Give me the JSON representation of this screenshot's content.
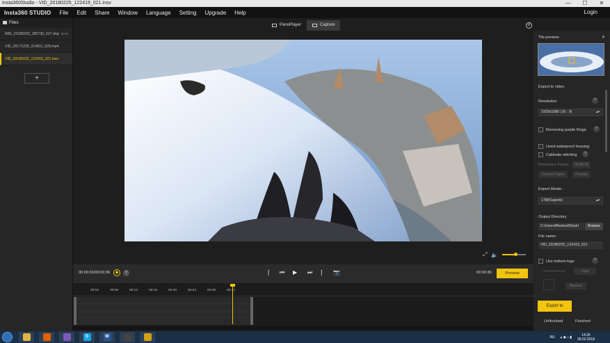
{
  "window": {
    "title": "Insta360Studio - VID_20180225_122419_021.insv",
    "min": "—",
    "max": "☐",
    "close": "✕"
  },
  "menubar": {
    "logo": "Insta360 STUDIO",
    "items": [
      "File",
      "Edit",
      "Share",
      "Window",
      "Language",
      "Setting",
      "Upgrade",
      "Help"
    ],
    "login": "Login"
  },
  "sidebar": {
    "header": "Files",
    "files": [
      {
        "name": "IMG_20180203_180730_017.dng",
        "badge": "RAW"
      },
      {
        "name": "VID_20171228_214811_029.mp4",
        "badge": ""
      },
      {
        "name": "VID_20180225_122419_021.insv",
        "badge": ""
      }
    ],
    "add_label": "+"
  },
  "view_tabs": [
    {
      "label": "PanoPlayer"
    },
    {
      "label": "Capture"
    }
  ],
  "player": {
    "current_time": "00:00:32/00:00:36",
    "end_time": "00:00:36",
    "preview_label": "Preview",
    "volume_fraction": 0.55
  },
  "timeline": {
    "ticks": [
      "00:04",
      "00:08",
      "00:12",
      "00:16",
      "00:20",
      "00:24",
      "00:28",
      "00:32"
    ],
    "playhead_label": "00:32"
  },
  "right_panel": {
    "tile_preview": "Tile preview",
    "export_to_video": "Export to video",
    "resolution_label": "Resolution",
    "resolution_value": "1920x1080 (16 : 9)",
    "removing_purple_fringe": "Removing purple fringe",
    "used_waterproof_housing": "Used waterproof housing",
    "calibrate_stitching": "Calibrate stitching",
    "reference_frame": "Reference Frame",
    "reference_frame_value": "00:00:18",
    "current_frame": "Current Frame",
    "preview": "Preview",
    "export_bitrate_label": "Export bitrate :",
    "export_bitrate_value": "17M(Superb)",
    "output_directory_label": "Output Directory",
    "output_directory_value": "C:\\Users\\Bezbod\\Deskt",
    "browse": "Browse",
    "file_name_label": "File name:",
    "file_name_value": "VID_20180225_122419_021",
    "use_bottom_logo": "Use bottom logo",
    "logo_btn": "Logo",
    "replace": "Replace",
    "export_to": "Export to",
    "unfinished": "Unfinished",
    "finished": "Finished",
    "help": "?"
  },
  "taskbar": {
    "apps": [
      {
        "icon": "folder-icon",
        "color": "#e3b341",
        "glyph": ""
      },
      {
        "icon": "firefox-icon",
        "color": "#e66000",
        "glyph": ""
      },
      {
        "icon": "viber-icon",
        "color": "#7d59b9",
        "glyph": ""
      },
      {
        "icon": "skype-icon",
        "color": "#1aa3e8",
        "glyph": "S"
      },
      {
        "icon": "word-icon",
        "color": "#2b5797",
        "glyph": "W"
      },
      {
        "icon": "app-icon",
        "color": "#444444",
        "glyph": ""
      },
      {
        "icon": "film-icon",
        "color": "#d4a017",
        "glyph": ""
      }
    ],
    "lang": "RU",
    "time": "14:26",
    "date": "28.02.2018"
  },
  "colors": {
    "accent": "#f1c40f",
    "background": "#1e1e1e",
    "panel": "#262626"
  }
}
